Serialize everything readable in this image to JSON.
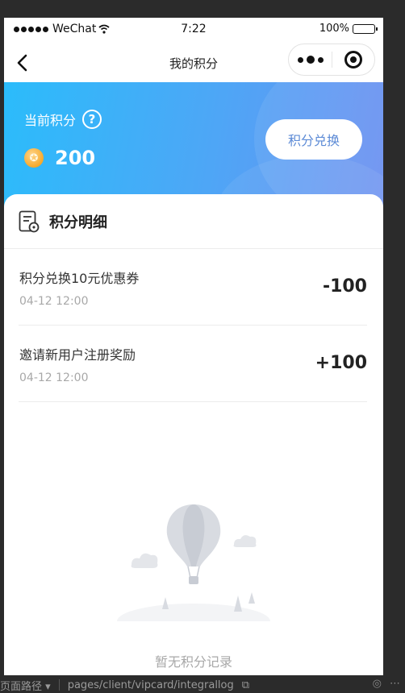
{
  "status_bar": {
    "signal_count": 5,
    "carrier": "WeChat",
    "time": "7:22",
    "battery": "100%"
  },
  "navbar": {
    "title": "我的积分"
  },
  "points": {
    "label": "当前积分",
    "value": "200",
    "redeem_label": "积分兑换"
  },
  "detail": {
    "title": "积分明细",
    "records": [
      {
        "name": "积分兑换10元优惠券",
        "time": "04-12 12:00",
        "amount": "-100"
      },
      {
        "name": "邀请新用户注册奖励",
        "time": "04-12 12:00",
        "amount": "+100"
      }
    ],
    "empty_text": "暂无积分记录"
  },
  "devtools": {
    "path_label": "页面路径",
    "path": "pages/client/vipcard/integrallog"
  },
  "colors": {
    "banner_start": "#2bbcfb",
    "banner_end": "#6b8ff0",
    "redeem_text": "#5d8bd6"
  },
  "icons": [
    "back-arrow-icon",
    "more-dots-icon",
    "close-target-icon",
    "help-icon",
    "coin-icon",
    "list-detail-icon",
    "balloon-illustration",
    "copy-icon",
    "eye-icon"
  ]
}
